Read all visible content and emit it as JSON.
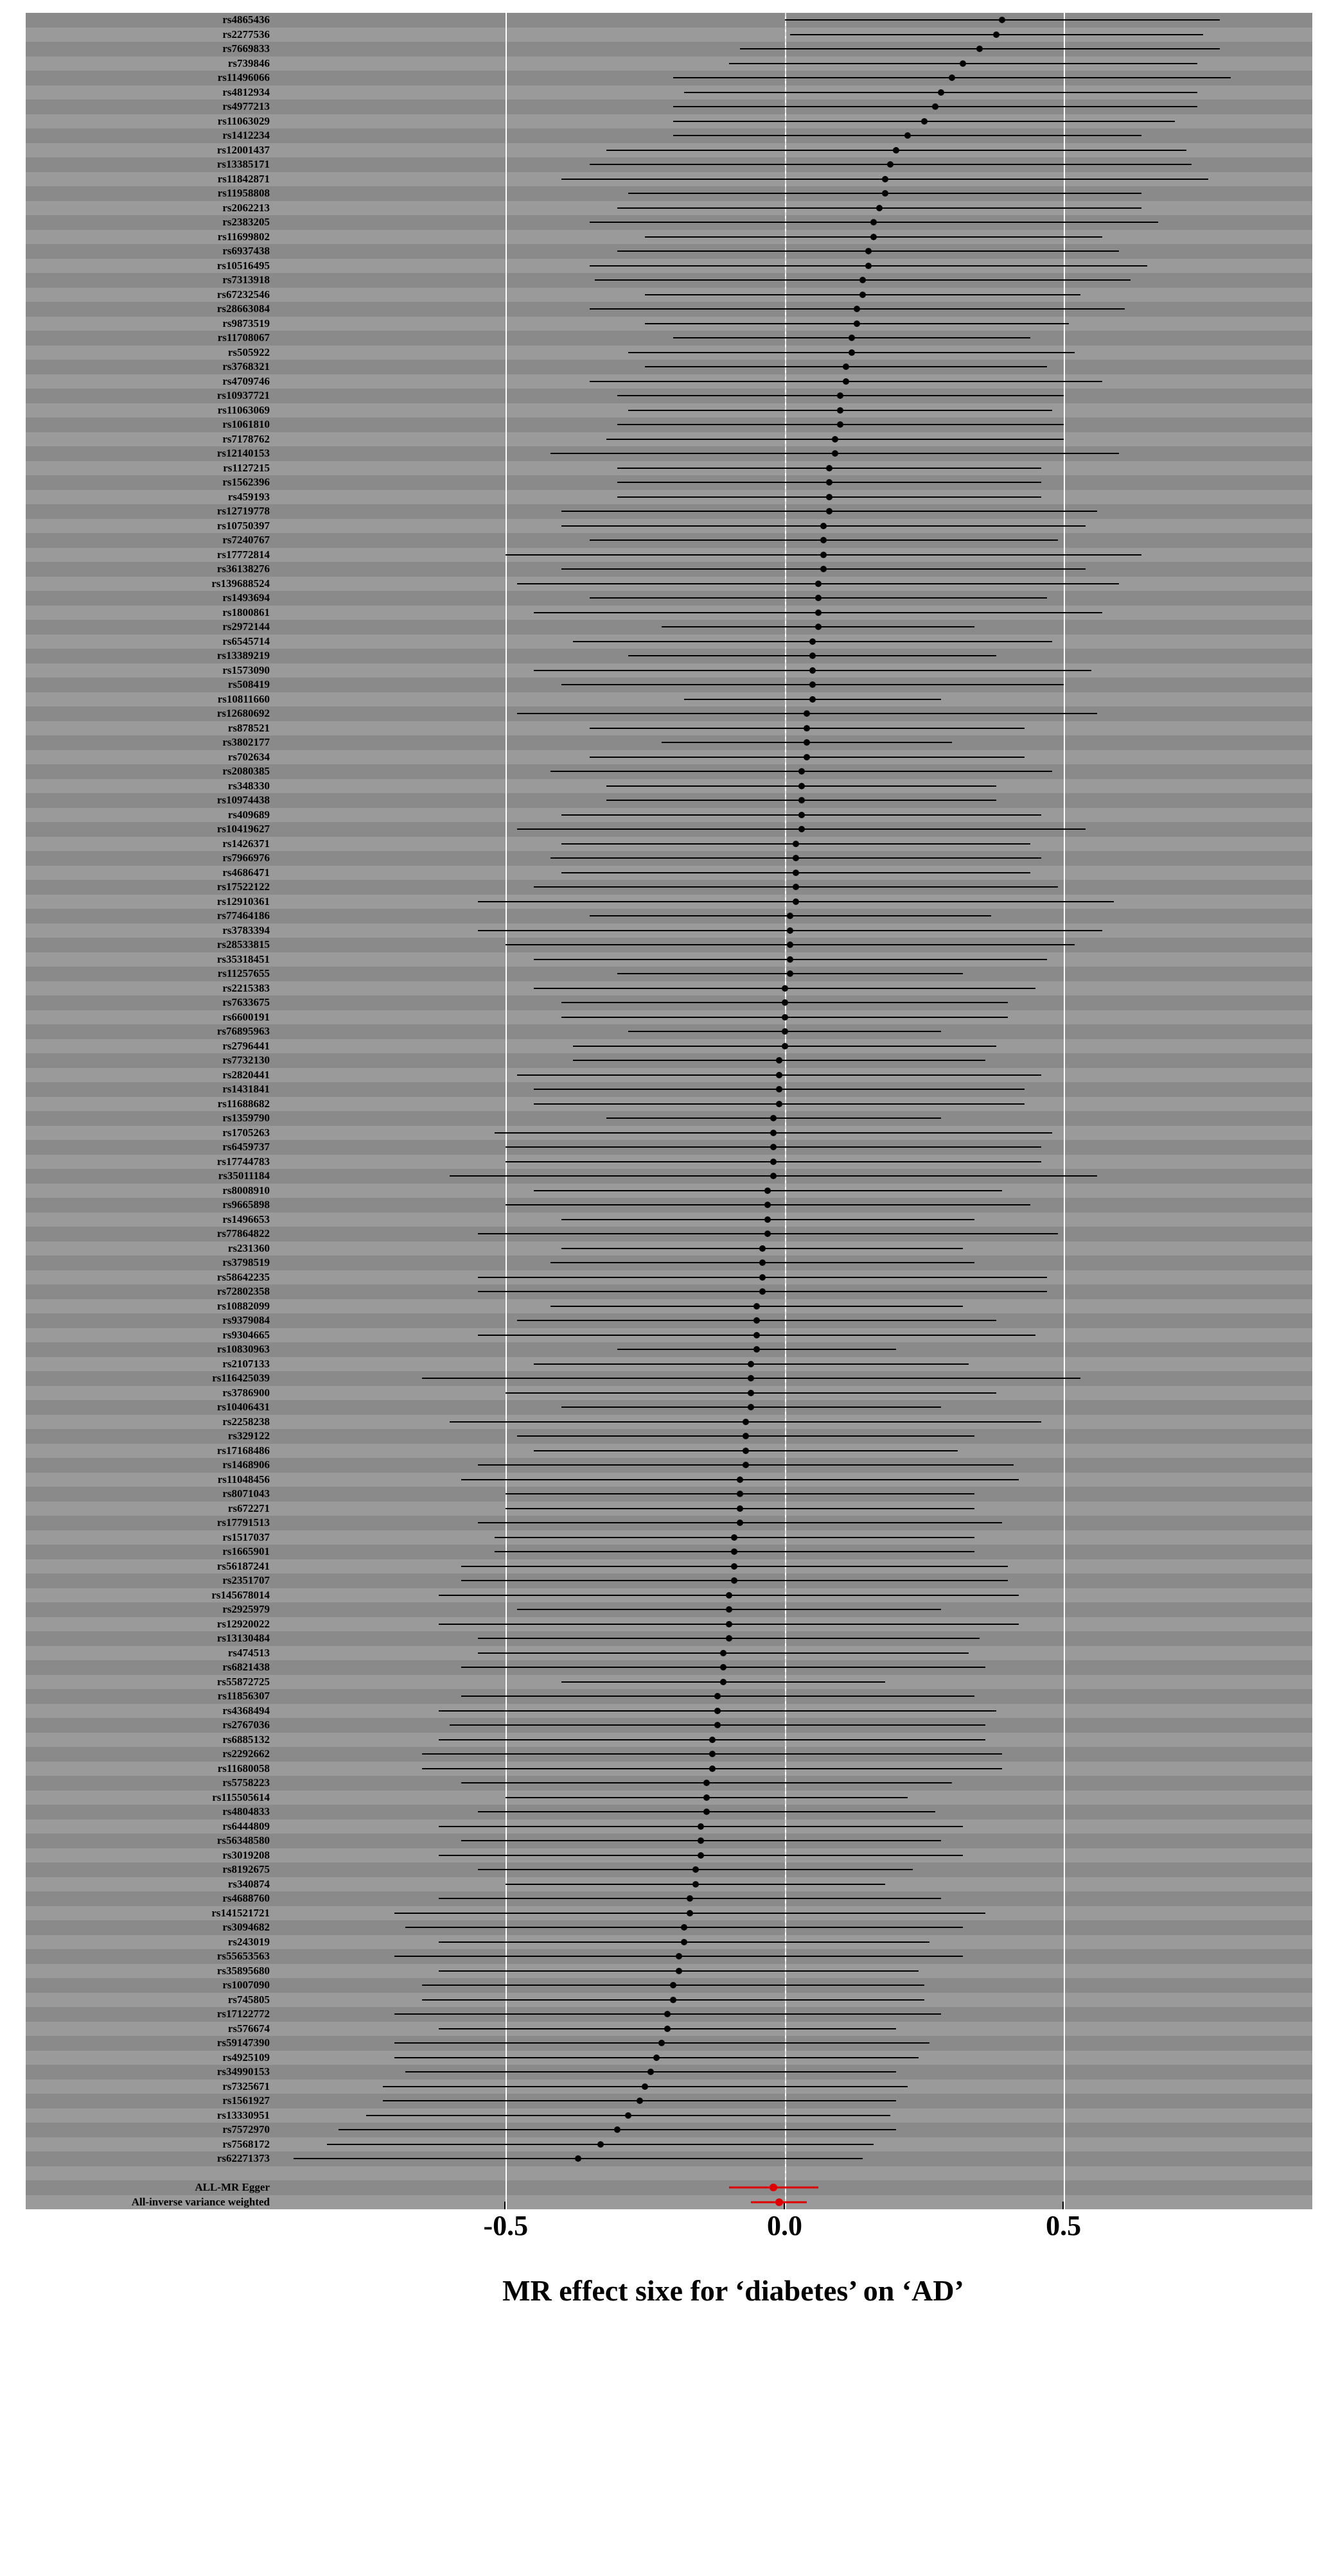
{
  "chart_data": {
    "type": "forest",
    "xlabel": "MR effect sixe for ‘diabetes’ on ‘AD’",
    "xlim": [
      -0.9,
      0.9
    ],
    "xticks": [
      -0.5,
      0.0,
      0.5
    ],
    "zero": 0.0,
    "rows": [
      {
        "label": "rs4865436",
        "est": 0.39,
        "lo": 0.0,
        "hi": 0.78
      },
      {
        "label": "rs2277536",
        "est": 0.38,
        "lo": 0.01,
        "hi": 0.75
      },
      {
        "label": "rs7669833",
        "est": 0.35,
        "lo": -0.08,
        "hi": 0.78
      },
      {
        "label": "rs739846",
        "est": 0.32,
        "lo": -0.1,
        "hi": 0.74
      },
      {
        "label": "rs11496066",
        "est": 0.3,
        "lo": -0.2,
        "hi": 0.8
      },
      {
        "label": "rs4812934",
        "est": 0.28,
        "lo": -0.18,
        "hi": 0.74
      },
      {
        "label": "rs4977213",
        "est": 0.27,
        "lo": -0.2,
        "hi": 0.74
      },
      {
        "label": "rs11063029",
        "est": 0.25,
        "lo": -0.2,
        "hi": 0.7
      },
      {
        "label": "rs1412234",
        "est": 0.22,
        "lo": -0.2,
        "hi": 0.64
      },
      {
        "label": "rs12001437",
        "est": 0.2,
        "lo": -0.32,
        "hi": 0.72
      },
      {
        "label": "rs13385171",
        "est": 0.19,
        "lo": -0.35,
        "hi": 0.73
      },
      {
        "label": "rs11842871",
        "est": 0.18,
        "lo": -0.4,
        "hi": 0.76
      },
      {
        "label": "rs11958808",
        "est": 0.18,
        "lo": -0.28,
        "hi": 0.64
      },
      {
        "label": "rs2062213",
        "est": 0.17,
        "lo": -0.3,
        "hi": 0.64
      },
      {
        "label": "rs2383205",
        "est": 0.16,
        "lo": -0.35,
        "hi": 0.67
      },
      {
        "label": "rs11699802",
        "est": 0.16,
        "lo": -0.25,
        "hi": 0.57
      },
      {
        "label": "rs6937438",
        "est": 0.15,
        "lo": -0.3,
        "hi": 0.6
      },
      {
        "label": "rs10516495",
        "est": 0.15,
        "lo": -0.35,
        "hi": 0.65
      },
      {
        "label": "rs7313918",
        "est": 0.14,
        "lo": -0.34,
        "hi": 0.62
      },
      {
        "label": "rs67232546",
        "est": 0.14,
        "lo": -0.25,
        "hi": 0.53
      },
      {
        "label": "rs28663084",
        "est": 0.13,
        "lo": -0.35,
        "hi": 0.61
      },
      {
        "label": "rs9873519",
        "est": 0.13,
        "lo": -0.25,
        "hi": 0.51
      },
      {
        "label": "rs11708067",
        "est": 0.12,
        "lo": -0.2,
        "hi": 0.44
      },
      {
        "label": "rs505922",
        "est": 0.12,
        "lo": -0.28,
        "hi": 0.52
      },
      {
        "label": "rs3768321",
        "est": 0.11,
        "lo": -0.25,
        "hi": 0.47
      },
      {
        "label": "rs4709746",
        "est": 0.11,
        "lo": -0.35,
        "hi": 0.57
      },
      {
        "label": "rs10937721",
        "est": 0.1,
        "lo": -0.3,
        "hi": 0.5
      },
      {
        "label": "rs11063069",
        "est": 0.1,
        "lo": -0.28,
        "hi": 0.48
      },
      {
        "label": "rs1061810",
        "est": 0.1,
        "lo": -0.3,
        "hi": 0.5
      },
      {
        "label": "rs7178762",
        "est": 0.09,
        "lo": -0.32,
        "hi": 0.5
      },
      {
        "label": "rs12140153",
        "est": 0.09,
        "lo": -0.42,
        "hi": 0.6
      },
      {
        "label": "rs1127215",
        "est": 0.08,
        "lo": -0.3,
        "hi": 0.46
      },
      {
        "label": "rs1562396",
        "est": 0.08,
        "lo": -0.3,
        "hi": 0.46
      },
      {
        "label": "rs459193",
        "est": 0.08,
        "lo": -0.3,
        "hi": 0.46
      },
      {
        "label": "rs12719778",
        "est": 0.08,
        "lo": -0.4,
        "hi": 0.56
      },
      {
        "label": "rs10750397",
        "est": 0.07,
        "lo": -0.4,
        "hi": 0.54
      },
      {
        "label": "rs7240767",
        "est": 0.07,
        "lo": -0.35,
        "hi": 0.49
      },
      {
        "label": "rs17772814",
        "est": 0.07,
        "lo": -0.5,
        "hi": 0.64
      },
      {
        "label": "rs36138276",
        "est": 0.07,
        "lo": -0.4,
        "hi": 0.54
      },
      {
        "label": "rs139688524",
        "est": 0.06,
        "lo": -0.48,
        "hi": 0.6
      },
      {
        "label": "rs1493694",
        "est": 0.06,
        "lo": -0.35,
        "hi": 0.47
      },
      {
        "label": "rs1800861",
        "est": 0.06,
        "lo": -0.45,
        "hi": 0.57
      },
      {
        "label": "rs2972144",
        "est": 0.06,
        "lo": -0.22,
        "hi": 0.34
      },
      {
        "label": "rs6545714",
        "est": 0.05,
        "lo": -0.38,
        "hi": 0.48
      },
      {
        "label": "rs13389219",
        "est": 0.05,
        "lo": -0.28,
        "hi": 0.38
      },
      {
        "label": "rs1573090",
        "est": 0.05,
        "lo": -0.45,
        "hi": 0.55
      },
      {
        "label": "rs508419",
        "est": 0.05,
        "lo": -0.4,
        "hi": 0.5
      },
      {
        "label": "rs10811660",
        "est": 0.05,
        "lo": -0.18,
        "hi": 0.28
      },
      {
        "label": "rs12680692",
        "est": 0.04,
        "lo": -0.48,
        "hi": 0.56
      },
      {
        "label": "rs878521",
        "est": 0.04,
        "lo": -0.35,
        "hi": 0.43
      },
      {
        "label": "rs3802177",
        "est": 0.04,
        "lo": -0.22,
        "hi": 0.3
      },
      {
        "label": "rs702634",
        "est": 0.04,
        "lo": -0.35,
        "hi": 0.43
      },
      {
        "label": "rs2080385",
        "est": 0.03,
        "lo": -0.42,
        "hi": 0.48
      },
      {
        "label": "rs348330",
        "est": 0.03,
        "lo": -0.32,
        "hi": 0.38
      },
      {
        "label": "rs10974438",
        "est": 0.03,
        "lo": -0.32,
        "hi": 0.38
      },
      {
        "label": "rs409689",
        "est": 0.03,
        "lo": -0.4,
        "hi": 0.46
      },
      {
        "label": "rs10419627",
        "est": 0.03,
        "lo": -0.48,
        "hi": 0.54
      },
      {
        "label": "rs1426371",
        "est": 0.02,
        "lo": -0.4,
        "hi": 0.44
      },
      {
        "label": "rs7966976",
        "est": 0.02,
        "lo": -0.42,
        "hi": 0.46
      },
      {
        "label": "rs4686471",
        "est": 0.02,
        "lo": -0.4,
        "hi": 0.44
      },
      {
        "label": "rs17522122",
        "est": 0.02,
        "lo": -0.45,
        "hi": 0.49
      },
      {
        "label": "rs12910361",
        "est": 0.02,
        "lo": -0.55,
        "hi": 0.59
      },
      {
        "label": "rs77464186",
        "est": 0.01,
        "lo": -0.35,
        "hi": 0.37
      },
      {
        "label": "rs3783394",
        "est": 0.01,
        "lo": -0.55,
        "hi": 0.57
      },
      {
        "label": "rs28533815",
        "est": 0.01,
        "lo": -0.5,
        "hi": 0.52
      },
      {
        "label": "rs35318451",
        "est": 0.01,
        "lo": -0.45,
        "hi": 0.47
      },
      {
        "label": "rs11257655",
        "est": 0.01,
        "lo": -0.3,
        "hi": 0.32
      },
      {
        "label": "rs2215383",
        "est": 0.0,
        "lo": -0.45,
        "hi": 0.45
      },
      {
        "label": "rs7633675",
        "est": 0.0,
        "lo": -0.4,
        "hi": 0.4
      },
      {
        "label": "rs6600191",
        "est": 0.0,
        "lo": -0.4,
        "hi": 0.4
      },
      {
        "label": "rs76895963",
        "est": 0.0,
        "lo": -0.28,
        "hi": 0.28
      },
      {
        "label": "rs2796441",
        "est": 0.0,
        "lo": -0.38,
        "hi": 0.38
      },
      {
        "label": "rs7732130",
        "est": -0.01,
        "lo": -0.38,
        "hi": 0.36
      },
      {
        "label": "rs2820441",
        "est": -0.01,
        "lo": -0.48,
        "hi": 0.46
      },
      {
        "label": "rs1431841",
        "est": -0.01,
        "lo": -0.45,
        "hi": 0.43
      },
      {
        "label": "rs11688682",
        "est": -0.01,
        "lo": -0.45,
        "hi": 0.43
      },
      {
        "label": "rs1359790",
        "est": -0.02,
        "lo": -0.32,
        "hi": 0.28
      },
      {
        "label": "rs1705263",
        "est": -0.02,
        "lo": -0.52,
        "hi": 0.48
      },
      {
        "label": "rs6459737",
        "est": -0.02,
        "lo": -0.5,
        "hi": 0.46
      },
      {
        "label": "rs17744783",
        "est": -0.02,
        "lo": -0.5,
        "hi": 0.46
      },
      {
        "label": "rs35011184",
        "est": -0.02,
        "lo": -0.6,
        "hi": 0.56
      },
      {
        "label": "rs8008910",
        "est": -0.03,
        "lo": -0.45,
        "hi": 0.39
      },
      {
        "label": "rs9665898",
        "est": -0.03,
        "lo": -0.5,
        "hi": 0.44
      },
      {
        "label": "rs1496653",
        "est": -0.03,
        "lo": -0.4,
        "hi": 0.34
      },
      {
        "label": "rs77864822",
        "est": -0.03,
        "lo": -0.55,
        "hi": 0.49
      },
      {
        "label": "rs231360",
        "est": -0.04,
        "lo": -0.4,
        "hi": 0.32
      },
      {
        "label": "rs3798519",
        "est": -0.04,
        "lo": -0.42,
        "hi": 0.34
      },
      {
        "label": "rs58642235",
        "est": -0.04,
        "lo": -0.55,
        "hi": 0.47
      },
      {
        "label": "rs72802358",
        "est": -0.04,
        "lo": -0.55,
        "hi": 0.47
      },
      {
        "label": "rs10882099",
        "est": -0.05,
        "lo": -0.42,
        "hi": 0.32
      },
      {
        "label": "rs9379084",
        "est": -0.05,
        "lo": -0.48,
        "hi": 0.38
      },
      {
        "label": "rs9304665",
        "est": -0.05,
        "lo": -0.55,
        "hi": 0.45
      },
      {
        "label": "rs10830963",
        "est": -0.05,
        "lo": -0.3,
        "hi": 0.2
      },
      {
        "label": "rs2107133",
        "est": -0.06,
        "lo": -0.45,
        "hi": 0.33
      },
      {
        "label": "rs116425039",
        "est": -0.06,
        "lo": -0.65,
        "hi": 0.53
      },
      {
        "label": "rs3786900",
        "est": -0.06,
        "lo": -0.5,
        "hi": 0.38
      },
      {
        "label": "rs10406431",
        "est": -0.06,
        "lo": -0.4,
        "hi": 0.28
      },
      {
        "label": "rs2258238",
        "est": -0.07,
        "lo": -0.6,
        "hi": 0.46
      },
      {
        "label": "rs329122",
        "est": -0.07,
        "lo": -0.48,
        "hi": 0.34
      },
      {
        "label": "rs17168486",
        "est": -0.07,
        "lo": -0.45,
        "hi": 0.31
      },
      {
        "label": "rs1468906",
        "est": -0.07,
        "lo": -0.55,
        "hi": 0.41
      },
      {
        "label": "rs11048456",
        "est": -0.08,
        "lo": -0.58,
        "hi": 0.42
      },
      {
        "label": "rs8071043",
        "est": -0.08,
        "lo": -0.5,
        "hi": 0.34
      },
      {
        "label": "rs672271",
        "est": -0.08,
        "lo": -0.5,
        "hi": 0.34
      },
      {
        "label": "rs17791513",
        "est": -0.08,
        "lo": -0.55,
        "hi": 0.39
      },
      {
        "label": "rs1517037",
        "est": -0.09,
        "lo": -0.52,
        "hi": 0.34
      },
      {
        "label": "rs1665901",
        "est": -0.09,
        "lo": -0.52,
        "hi": 0.34
      },
      {
        "label": "rs56187241",
        "est": -0.09,
        "lo": -0.58,
        "hi": 0.4
      },
      {
        "label": "rs2351707",
        "est": -0.09,
        "lo": -0.58,
        "hi": 0.4
      },
      {
        "label": "rs145678014",
        "est": -0.1,
        "lo": -0.62,
        "hi": 0.42
      },
      {
        "label": "rs2925979",
        "est": -0.1,
        "lo": -0.48,
        "hi": 0.28
      },
      {
        "label": "rs12920022",
        "est": -0.1,
        "lo": -0.62,
        "hi": 0.42
      },
      {
        "label": "rs13130484",
        "est": -0.1,
        "lo": -0.55,
        "hi": 0.35
      },
      {
        "label": "rs474513",
        "est": -0.11,
        "lo": -0.55,
        "hi": 0.33
      },
      {
        "label": "rs6821438",
        "est": -0.11,
        "lo": -0.58,
        "hi": 0.36
      },
      {
        "label": "rs55872725",
        "est": -0.11,
        "lo": -0.4,
        "hi": 0.18
      },
      {
        "label": "rs11856307",
        "est": -0.12,
        "lo": -0.58,
        "hi": 0.34
      },
      {
        "label": "rs4368494",
        "est": -0.12,
        "lo": -0.62,
        "hi": 0.38
      },
      {
        "label": "rs2767036",
        "est": -0.12,
        "lo": -0.6,
        "hi": 0.36
      },
      {
        "label": "rs6885132",
        "est": -0.13,
        "lo": -0.62,
        "hi": 0.36
      },
      {
        "label": "rs2292662",
        "est": -0.13,
        "lo": -0.65,
        "hi": 0.39
      },
      {
        "label": "rs11680058",
        "est": -0.13,
        "lo": -0.65,
        "hi": 0.39
      },
      {
        "label": "rs5758223",
        "est": -0.14,
        "lo": -0.58,
        "hi": 0.3
      },
      {
        "label": "rs115505614",
        "est": -0.14,
        "lo": -0.5,
        "hi": 0.22
      },
      {
        "label": "rs4804833",
        "est": -0.14,
        "lo": -0.55,
        "hi": 0.27
      },
      {
        "label": "rs6444809",
        "est": -0.15,
        "lo": -0.62,
        "hi": 0.32
      },
      {
        "label": "rs56348580",
        "est": -0.15,
        "lo": -0.58,
        "hi": 0.28
      },
      {
        "label": "rs3019208",
        "est": -0.15,
        "lo": -0.62,
        "hi": 0.32
      },
      {
        "label": "rs8192675",
        "est": -0.16,
        "lo": -0.55,
        "hi": 0.23
      },
      {
        "label": "rs340874",
        "est": -0.16,
        "lo": -0.5,
        "hi": 0.18
      },
      {
        "label": "rs4688760",
        "est": -0.17,
        "lo": -0.62,
        "hi": 0.28
      },
      {
        "label": "rs141521721",
        "est": -0.17,
        "lo": -0.7,
        "hi": 0.36
      },
      {
        "label": "rs3094682",
        "est": -0.18,
        "lo": -0.68,
        "hi": 0.32
      },
      {
        "label": "rs243019",
        "est": -0.18,
        "lo": -0.62,
        "hi": 0.26
      },
      {
        "label": "rs55653563",
        "est": -0.19,
        "lo": -0.7,
        "hi": 0.32
      },
      {
        "label": "rs35895680",
        "est": -0.19,
        "lo": -0.62,
        "hi": 0.24
      },
      {
        "label": "rs1007090",
        "est": -0.2,
        "lo": -0.65,
        "hi": 0.25
      },
      {
        "label": "rs745805",
        "est": -0.2,
        "lo": -0.65,
        "hi": 0.25
      },
      {
        "label": "rs17122772",
        "est": -0.21,
        "lo": -0.7,
        "hi": 0.28
      },
      {
        "label": "rs576674",
        "est": -0.21,
        "lo": -0.62,
        "hi": 0.2
      },
      {
        "label": "rs59147390",
        "est": -0.22,
        "lo": -0.7,
        "hi": 0.26
      },
      {
        "label": "rs4925109",
        "est": -0.23,
        "lo": -0.7,
        "hi": 0.24
      },
      {
        "label": "rs34990153",
        "est": -0.24,
        "lo": -0.68,
        "hi": 0.2
      },
      {
        "label": "rs7325671",
        "est": -0.25,
        "lo": -0.72,
        "hi": 0.22
      },
      {
        "label": "rs1561927",
        "est": -0.26,
        "lo": -0.72,
        "hi": 0.2
      },
      {
        "label": "rs13330951",
        "est": -0.28,
        "lo": -0.75,
        "hi": 0.19
      },
      {
        "label": "rs7572970",
        "est": -0.3,
        "lo": -0.8,
        "hi": 0.2
      },
      {
        "label": "rs7568172",
        "est": -0.33,
        "lo": -0.82,
        "hi": 0.16
      },
      {
        "label": "rs62271373",
        "est": -0.37,
        "lo": -0.88,
        "hi": 0.14
      },
      {
        "label": "",
        "est": null,
        "lo": null,
        "hi": null
      },
      {
        "label": "ALL-MR Egger",
        "est": -0.02,
        "lo": -0.1,
        "hi": 0.06,
        "red": true
      },
      {
        "label": "All-inverse variance weighted",
        "est": -0.01,
        "lo": -0.06,
        "hi": 0.04,
        "red": true
      }
    ]
  }
}
